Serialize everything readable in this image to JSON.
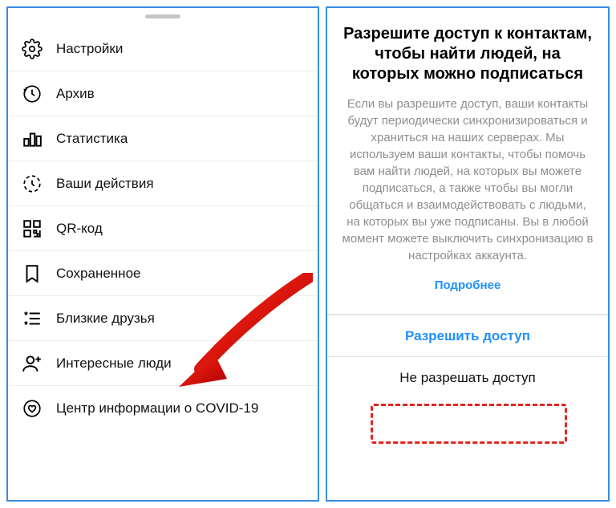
{
  "menu": {
    "items": [
      {
        "key": "settings",
        "label": "Настройки"
      },
      {
        "key": "archive",
        "label": "Архив"
      },
      {
        "key": "insights",
        "label": "Статистика"
      },
      {
        "key": "your-activity",
        "label": "Ваши действия"
      },
      {
        "key": "qr-code",
        "label": "QR-код"
      },
      {
        "key": "saved",
        "label": "Сохраненное"
      },
      {
        "key": "close-friends",
        "label": "Близкие друзья"
      },
      {
        "key": "discover",
        "label": "Интересные люди"
      },
      {
        "key": "covid",
        "label": "Центр информации о COVID-19"
      }
    ]
  },
  "dialog": {
    "title": "Разрешите доступ к контактам, чтобы найти людей, на которых можно подписаться",
    "body": "Если вы разрешите доступ, ваши контакты будут периодически синхронизироваться и храниться на наших серверах. Мы используем ваши контакты, чтобы помочь вам найти людей, на которых вы можете подписаться, а также чтобы вы могли общаться и взаимодействовать с людьми, на которых вы уже подписаны. Вы в любой момент можете выключить синхронизацию в настройках аккаунта.",
    "learn_more": "Подробнее",
    "allow": "Разрешить доступ",
    "deny": "Не разрешать доступ"
  },
  "colors": {
    "link": "#1e90ff",
    "panel_border": "#3a8de0",
    "highlight": "#e2261e",
    "arrow": "#d00000"
  }
}
